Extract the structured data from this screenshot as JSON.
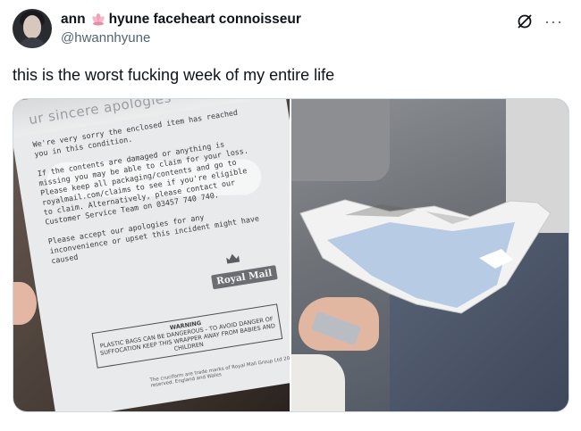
{
  "author": {
    "name_part1": "ann",
    "name_part2": "hyune faceheart connoisseur",
    "handle": "@hwannhyune",
    "emoji_icon": "lotus-flower-icon"
  },
  "tweet": {
    "text": "this is the worst fucking week of my entire life"
  },
  "header_actions": {
    "grok_icon": "grok-icon",
    "more_label": "···"
  },
  "media": {
    "left_photo": {
      "title": "ur sincere apologies",
      "paragraph": "We're very sorry the enclosed item has reached\nyou in this condition.\n\nIf the contents are damaged or anything is\nmissing you may be able to claim for your loss.\nPlease keep all packaging/contents and go to\nroyalmail.com/claims to see if you're eligible\nto claim. Alternatively, please contact our\nCustomer Service Team on 03457 740 740.\n\nPlease accept our apologies for any\ninconvenience or upset this incident might have\ncaused",
      "logo_text": "Royal Mail",
      "warning_title": "WARNING",
      "warning_text": "PLASTIC BAGS CAN BE DANGEROUS - TO AVOID DANGER OF SUFFOCATION KEEP THIS WRAPPER AWAY FROM BABIES AND CHILDREN",
      "footer_text": "The cruciform are trade marks of Royal Mail Group Ltd 2023. All rights reserved. England and Wales"
    },
    "right_photo": {
      "description_icon": "torn-envelope"
    }
  },
  "colors": {
    "text_primary": "#0f1419",
    "text_secondary": "#536471",
    "border": "#cfd9de"
  }
}
